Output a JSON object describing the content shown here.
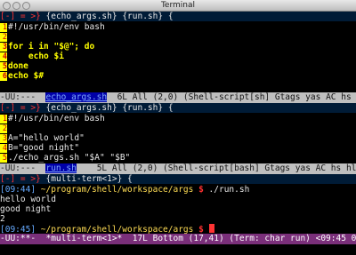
{
  "window": {
    "title": "Terminal"
  },
  "top": {
    "header": {
      "mark": "[-] = >}",
      "buffer": "{echo_args.sh}",
      "other": "{run.sh}",
      "tail": "{"
    },
    "lines": [
      {
        "n": "1",
        "text": "#!/usr/bin/env bash"
      },
      {
        "n": "2",
        "text": ""
      },
      {
        "n": "3",
        "text": "for i in \"$@\"; do"
      },
      {
        "n": "4",
        "text": "    echo $i"
      },
      {
        "n": "5",
        "text": "done"
      },
      {
        "n": "6",
        "text": "echo $#"
      }
    ],
    "modeline": {
      "pre": "-UU:---  ",
      "buffer": "echo_args.sh",
      "rest": "  6L All (2,0) (Shell-script[sh] Gtags yas AC hs hl-s hcl"
    }
  },
  "middle": {
    "header": {
      "mark": "[-] = >}",
      "buffer": "{echo_args.sh}",
      "other": "{run.sh}",
      "tail": "{"
    },
    "lines": [
      {
        "n": "1",
        "text": "#!/usr/bin/env bash"
      },
      {
        "n": "2",
        "text": ""
      },
      {
        "n": "3",
        "text": "A=\"hello world\""
      },
      {
        "n": "4",
        "text": "B=\"good night\""
      },
      {
        "n": "5",
        "text": "./echo_args.sh \"$A\" \"$B\""
      }
    ],
    "modeline": {
      "pre": "-UU:---  ",
      "buffer": "run.sh",
      "rest": "    5L All (2,0) (Shell-script[bash] Gtags yas AC hs hl-s"
    }
  },
  "term": {
    "header": {
      "mark": "[-] = >}",
      "buffer": "{multi-term<1>}",
      "tail": "{"
    },
    "prompt1": {
      "time": "[09:44]",
      "path": " ~/program/shell/workspace/args ",
      "dollar": "$",
      "cmd": " ./run.sh"
    },
    "output": [
      "hello world",
      "good night",
      "2"
    ],
    "prompt2": {
      "time": "[09:45]",
      "path": " ~/program/shell/workspace/args ",
      "dollar": "$"
    },
    "modeline": {
      "pre": "-UU:**-  ",
      "buffer": "*multi-term<1>*",
      "rest": "  17L Bottom (17,41) (Term: char run) <09:45 03-08 Tuesda"
    }
  }
}
